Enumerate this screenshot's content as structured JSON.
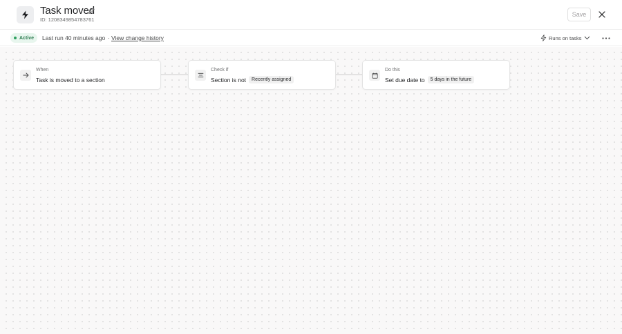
{
  "header": {
    "title": "Task moved",
    "rule_id": "ID: 1208349854783761",
    "save_label": "Save",
    "icons": {
      "rule": "lightning-icon",
      "edit": "pencil-icon",
      "close": "close-icon"
    }
  },
  "status": {
    "badge": "Active",
    "last_run": "Last run 40 minutes ago",
    "separator": "·",
    "history_link": "View change history",
    "runs_on": "Runs on tasks"
  },
  "workflow": {
    "steps": [
      {
        "kicker": "When",
        "text": "Task is moved to a section",
        "chip": "",
        "icon": "arrow-right-icon"
      },
      {
        "kicker": "Check if",
        "text": "Section is not",
        "chip": "Recently assigned",
        "icon": "branch-icon"
      },
      {
        "kicker": "Do this",
        "text": "Set due date to",
        "chip": "5 days in the future",
        "icon": "calendar-icon"
      }
    ]
  },
  "colors": {
    "accent_green": "#2ea05f",
    "badge_bg": "#e8f6ee",
    "canvas_bg": "#f9f8f8",
    "text": "#1e1f21"
  }
}
